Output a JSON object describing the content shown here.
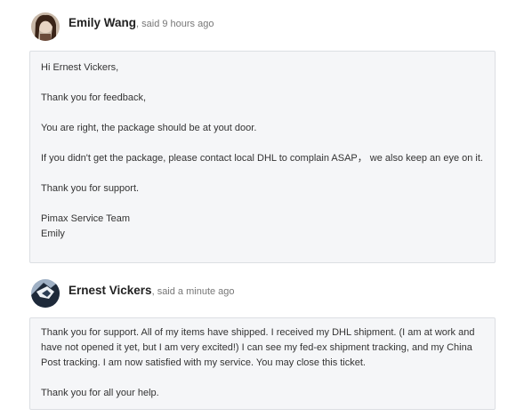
{
  "comments": [
    {
      "author": "Emily Wang",
      "said": ", said 9 hours ago",
      "paragraphs": [
        "Hi Ernest Vickers,",
        "Thank you for feedback,",
        "You are right, the package should be at yout door.",
        "If you didn't get the package, please contact local DHL to complain ASAP， we also keep an eye on it.",
        "Thank you for support."
      ],
      "signature": [
        "Pimax Service Team",
        "Emily"
      ]
    },
    {
      "author": "Ernest Vickers",
      "said": ", said a minute ago",
      "paragraphs": [
        "Thank you for support. All of my items have shipped. I received my DHL shipment. (I am at work and have not opened it yet, but I am very excited!) I can see my fed-ex shipment tracking, and my China Post tracking. I am now satisfied with my service. You may close this ticket.",
        "Thank you for all your help."
      ]
    }
  ]
}
